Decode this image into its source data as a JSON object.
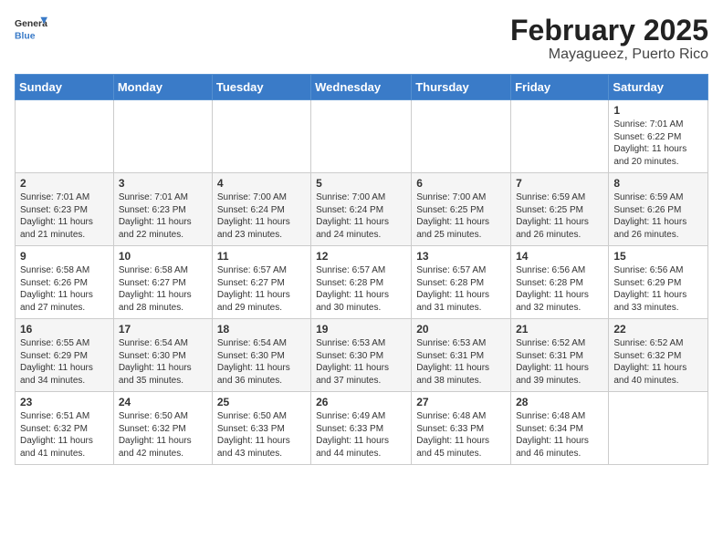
{
  "logo": {
    "general": "General",
    "blue": "Blue"
  },
  "header": {
    "month": "February 2025",
    "location": "Mayagueez, Puerto Rico"
  },
  "weekdays": [
    "Sunday",
    "Monday",
    "Tuesday",
    "Wednesday",
    "Thursday",
    "Friday",
    "Saturday"
  ],
  "weeks": [
    [
      {
        "day": "",
        "info": ""
      },
      {
        "day": "",
        "info": ""
      },
      {
        "day": "",
        "info": ""
      },
      {
        "day": "",
        "info": ""
      },
      {
        "day": "",
        "info": ""
      },
      {
        "day": "",
        "info": ""
      },
      {
        "day": "1",
        "info": "Sunrise: 7:01 AM\nSunset: 6:22 PM\nDaylight: 11 hours\nand 20 minutes."
      }
    ],
    [
      {
        "day": "2",
        "info": "Sunrise: 7:01 AM\nSunset: 6:23 PM\nDaylight: 11 hours\nand 21 minutes."
      },
      {
        "day": "3",
        "info": "Sunrise: 7:01 AM\nSunset: 6:23 PM\nDaylight: 11 hours\nand 22 minutes."
      },
      {
        "day": "4",
        "info": "Sunrise: 7:00 AM\nSunset: 6:24 PM\nDaylight: 11 hours\nand 23 minutes."
      },
      {
        "day": "5",
        "info": "Sunrise: 7:00 AM\nSunset: 6:24 PM\nDaylight: 11 hours\nand 24 minutes."
      },
      {
        "day": "6",
        "info": "Sunrise: 7:00 AM\nSunset: 6:25 PM\nDaylight: 11 hours\nand 25 minutes."
      },
      {
        "day": "7",
        "info": "Sunrise: 6:59 AM\nSunset: 6:25 PM\nDaylight: 11 hours\nand 26 minutes."
      },
      {
        "day": "8",
        "info": "Sunrise: 6:59 AM\nSunset: 6:26 PM\nDaylight: 11 hours\nand 26 minutes."
      }
    ],
    [
      {
        "day": "9",
        "info": "Sunrise: 6:58 AM\nSunset: 6:26 PM\nDaylight: 11 hours\nand 27 minutes."
      },
      {
        "day": "10",
        "info": "Sunrise: 6:58 AM\nSunset: 6:27 PM\nDaylight: 11 hours\nand 28 minutes."
      },
      {
        "day": "11",
        "info": "Sunrise: 6:57 AM\nSunset: 6:27 PM\nDaylight: 11 hours\nand 29 minutes."
      },
      {
        "day": "12",
        "info": "Sunrise: 6:57 AM\nSunset: 6:28 PM\nDaylight: 11 hours\nand 30 minutes."
      },
      {
        "day": "13",
        "info": "Sunrise: 6:57 AM\nSunset: 6:28 PM\nDaylight: 11 hours\nand 31 minutes."
      },
      {
        "day": "14",
        "info": "Sunrise: 6:56 AM\nSunset: 6:28 PM\nDaylight: 11 hours\nand 32 minutes."
      },
      {
        "day": "15",
        "info": "Sunrise: 6:56 AM\nSunset: 6:29 PM\nDaylight: 11 hours\nand 33 minutes."
      }
    ],
    [
      {
        "day": "16",
        "info": "Sunrise: 6:55 AM\nSunset: 6:29 PM\nDaylight: 11 hours\nand 34 minutes."
      },
      {
        "day": "17",
        "info": "Sunrise: 6:54 AM\nSunset: 6:30 PM\nDaylight: 11 hours\nand 35 minutes."
      },
      {
        "day": "18",
        "info": "Sunrise: 6:54 AM\nSunset: 6:30 PM\nDaylight: 11 hours\nand 36 minutes."
      },
      {
        "day": "19",
        "info": "Sunrise: 6:53 AM\nSunset: 6:30 PM\nDaylight: 11 hours\nand 37 minutes."
      },
      {
        "day": "20",
        "info": "Sunrise: 6:53 AM\nSunset: 6:31 PM\nDaylight: 11 hours\nand 38 minutes."
      },
      {
        "day": "21",
        "info": "Sunrise: 6:52 AM\nSunset: 6:31 PM\nDaylight: 11 hours\nand 39 minutes."
      },
      {
        "day": "22",
        "info": "Sunrise: 6:52 AM\nSunset: 6:32 PM\nDaylight: 11 hours\nand 40 minutes."
      }
    ],
    [
      {
        "day": "23",
        "info": "Sunrise: 6:51 AM\nSunset: 6:32 PM\nDaylight: 11 hours\nand 41 minutes."
      },
      {
        "day": "24",
        "info": "Sunrise: 6:50 AM\nSunset: 6:32 PM\nDaylight: 11 hours\nand 42 minutes."
      },
      {
        "day": "25",
        "info": "Sunrise: 6:50 AM\nSunset: 6:33 PM\nDaylight: 11 hours\nand 43 minutes."
      },
      {
        "day": "26",
        "info": "Sunrise: 6:49 AM\nSunset: 6:33 PM\nDaylight: 11 hours\nand 44 minutes."
      },
      {
        "day": "27",
        "info": "Sunrise: 6:48 AM\nSunset: 6:33 PM\nDaylight: 11 hours\nand 45 minutes."
      },
      {
        "day": "28",
        "info": "Sunrise: 6:48 AM\nSunset: 6:34 PM\nDaylight: 11 hours\nand 46 minutes."
      },
      {
        "day": "",
        "info": ""
      }
    ]
  ]
}
